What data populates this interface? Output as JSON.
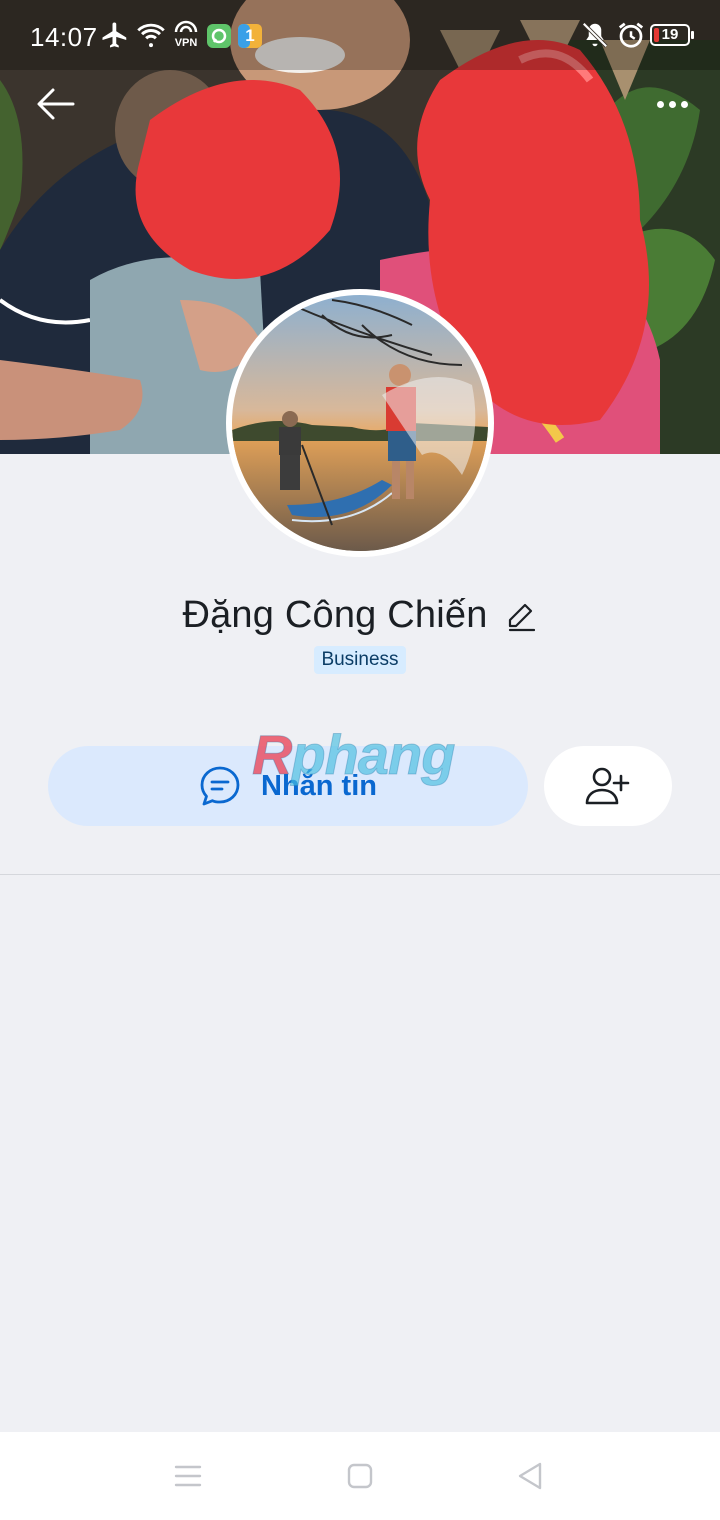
{
  "status_bar": {
    "time": "14:07",
    "vpn_label": "VPN",
    "app_badge": "1",
    "battery_level": "19",
    "icons": [
      "airplane-icon",
      "wifi-icon",
      "vpn-icon",
      "app-notification-icon",
      "app-notification-icon",
      "mute-vibrate-icon",
      "alarm-icon",
      "battery-icon"
    ]
  },
  "header": {
    "back_icon": "arrow-left-icon",
    "more_icon": "more-horizontal-icon"
  },
  "profile": {
    "name": "Đặng Công Chiến",
    "tag": "Business",
    "edit_icon": "pencil-icon"
  },
  "actions": {
    "message_label": "Nhắn tin",
    "message_icon": "chat-bubble-icon",
    "add_friend_icon": "user-plus-icon"
  },
  "watermark": {
    "first": "R",
    "rest": "phang"
  },
  "nav_bar": {
    "icons": [
      "menu-icon",
      "home-square-icon",
      "back-triangle-icon"
    ]
  },
  "colors": {
    "accent": "#0a68d0",
    "message_button_bg": "#dbe9fd",
    "tag_bg": "#d7ecff",
    "page_bg": "#eff0f4",
    "battery_low": "#e53935"
  }
}
